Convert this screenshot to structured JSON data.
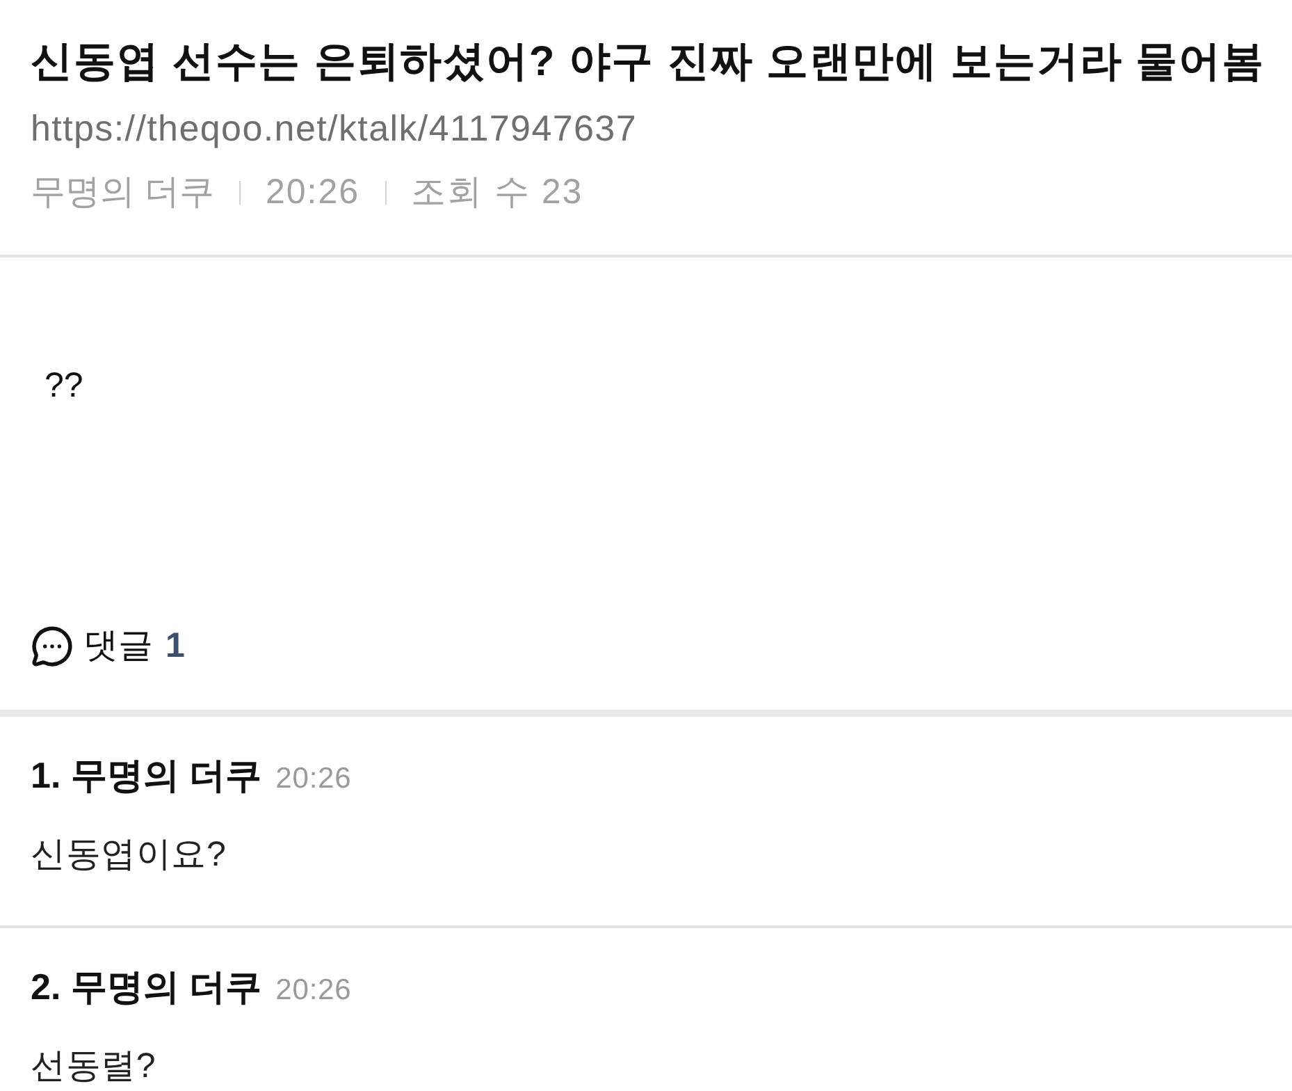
{
  "post": {
    "title": "신동엽 선수는 은퇴하셨어? 야구 진짜 오랜만에 보는거라 물어봄",
    "url": "https://theqoo.net/ktalk/4117947637",
    "meta": [
      "무명의 더쿠",
      "20:26",
      "조회 수 23"
    ],
    "body": "??"
  },
  "comments_header": {
    "label": "댓글",
    "count": "1"
  },
  "comments": [
    {
      "number": "1.",
      "author": "무명의 더쿠",
      "time": "20:26",
      "text": "신동엽이요?"
    },
    {
      "number": "2.",
      "author": "무명의 더쿠",
      "time": "20:26",
      "text": "선동렬?"
    }
  ]
}
